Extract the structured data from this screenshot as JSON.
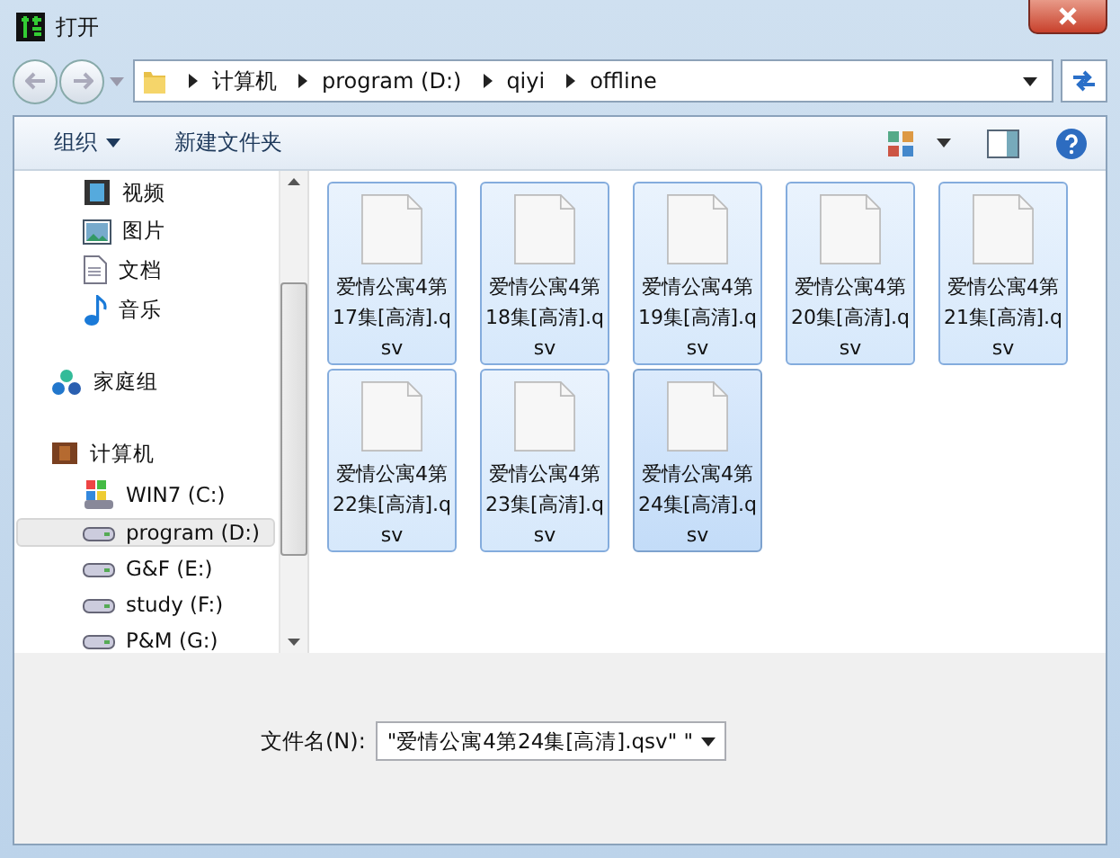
{
  "window": {
    "title": "打开"
  },
  "address": {
    "segments": [
      "计算机",
      "program (D:)",
      "qiyi",
      "offline"
    ]
  },
  "toolbar": {
    "organize": "组织",
    "new_folder": "新建文件夹"
  },
  "libraries": [
    {
      "label": "视频",
      "kind": "video",
      "selected": false
    },
    {
      "label": "图片",
      "kind": "picture",
      "selected": false
    },
    {
      "label": "文档",
      "kind": "document",
      "selected": false
    },
    {
      "label": "音乐",
      "kind": "music",
      "selected": false
    }
  ],
  "homegroup": {
    "label": "家庭组"
  },
  "computer": {
    "label": "计算机",
    "children": [
      {
        "label": "WIN7 (C:)",
        "kind": "system",
        "selected": false
      },
      {
        "label": "program (D:)",
        "kind": "drive",
        "selected": true
      },
      {
        "label": "G&F (E:)",
        "kind": "drive",
        "selected": false
      },
      {
        "label": "study (F:)",
        "kind": "drive",
        "selected": false
      },
      {
        "label": "P&M (G:)",
        "kind": "drive",
        "selected": false
      }
    ]
  },
  "files": [
    {
      "name": "爱情公寓4第17集[高清].qsv",
      "selected": true,
      "focused": false
    },
    {
      "name": "爱情公寓4第18集[高清].qsv",
      "selected": true,
      "focused": false
    },
    {
      "name": "爱情公寓4第19集[高清].qsv",
      "selected": true,
      "focused": false
    },
    {
      "name": "爱情公寓4第20集[高清].qsv",
      "selected": true,
      "focused": false
    },
    {
      "name": "爱情公寓4第21集[高清].qsv",
      "selected": true,
      "focused": false
    },
    {
      "name": "爱情公寓4第22集[高清].qsv",
      "selected": true,
      "focused": false
    },
    {
      "name": "爱情公寓4第23集[高清].qsv",
      "selected": true,
      "focused": false
    },
    {
      "name": "爱情公寓4第24集[高清].qsv",
      "selected": true,
      "focused": true
    }
  ],
  "filename": {
    "label": "文件名(N):",
    "value": "\"爱情公寓4第24集[高清].qsv\" \""
  }
}
